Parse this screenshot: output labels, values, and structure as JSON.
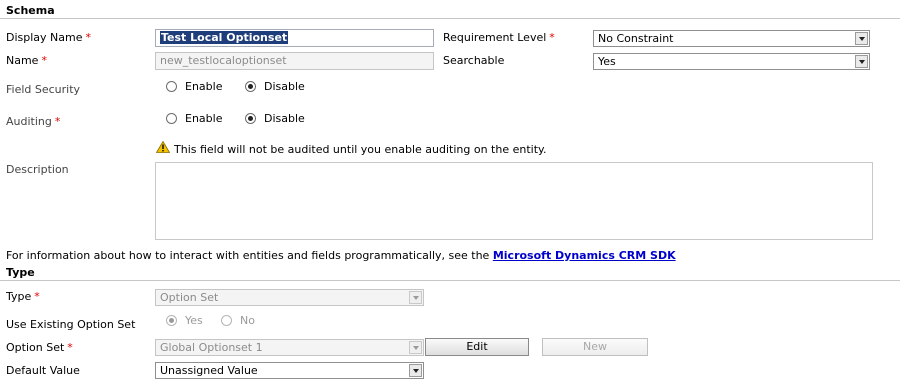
{
  "schema": {
    "section_title": "Schema",
    "display_name": {
      "label": "Display Name",
      "value": "Test Local Optionset"
    },
    "requirement_level": {
      "label": "Requirement Level",
      "value": "No Constraint"
    },
    "name": {
      "label": "Name",
      "value": "new_testlocaloptionset"
    },
    "searchable": {
      "label": "Searchable",
      "value": "Yes"
    },
    "field_security": {
      "label": "Field Security",
      "enable": "Enable",
      "disable": "Disable",
      "selected": "Disable"
    },
    "auditing": {
      "label": "Auditing",
      "enable": "Enable",
      "disable": "Disable",
      "selected": "Disable"
    },
    "audit_warning": "This field will not be audited until you enable auditing on the entity.",
    "description": {
      "label": "Description",
      "value": ""
    },
    "info_text": "For information about how to interact with entities and fields programmatically, see the",
    "info_link": "Microsoft Dynamics CRM SDK"
  },
  "type_section": {
    "section_title": "Type",
    "type": {
      "label": "Type",
      "value": "Option Set"
    },
    "use_existing": {
      "label": "Use Existing Option Set",
      "yes": "Yes",
      "no": "No",
      "selected": "Yes"
    },
    "option_set": {
      "label": "Option Set",
      "value": "Global Optionset 1",
      "edit_label": "Edit",
      "new_label": "New"
    },
    "default_value": {
      "label": "Default Value",
      "value": "Unassigned Value"
    }
  },
  "required_marker": "*",
  "icons": {
    "warning": "warning-triangle-icon",
    "dropdown": "chevron-down-icon"
  },
  "colors": {
    "required": "#e00000",
    "link": "#0000cc",
    "selection": "#1f3d7a",
    "warning": "#f2c200"
  }
}
